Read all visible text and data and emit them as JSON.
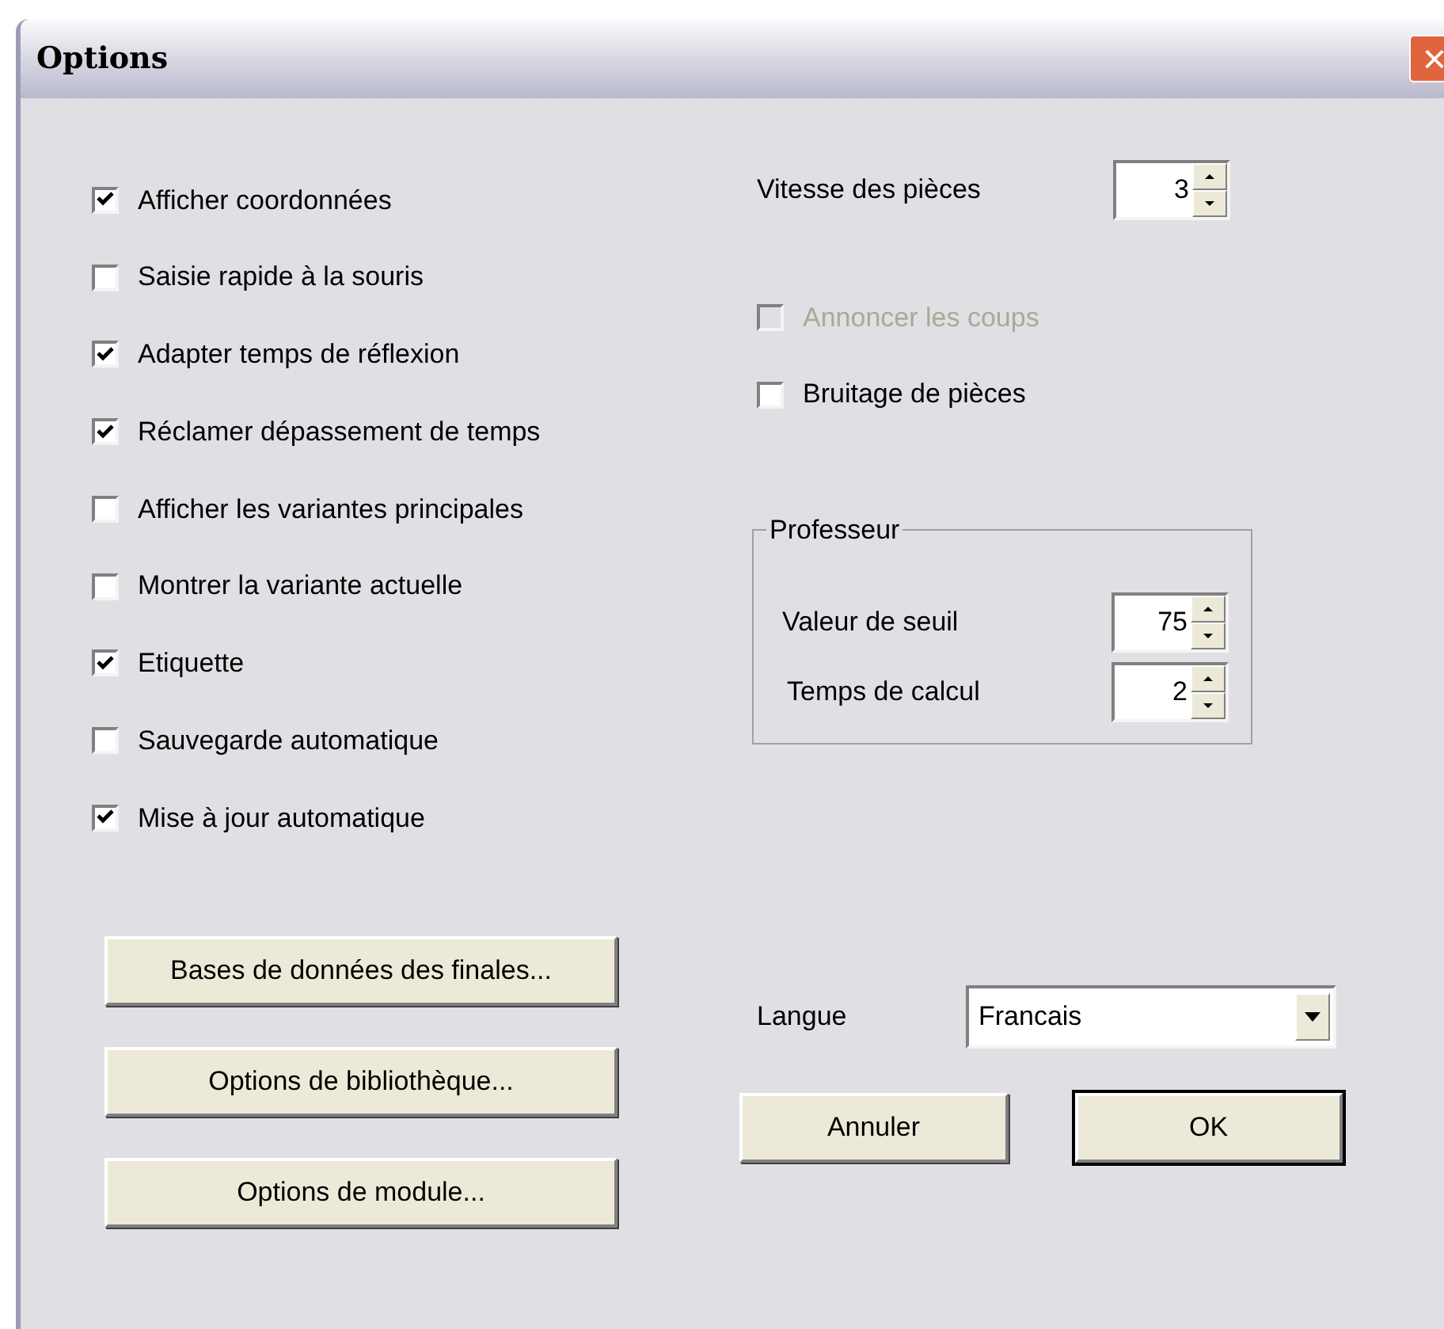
{
  "window": {
    "title": "Options",
    "close": "×"
  },
  "options": [
    {
      "label": "Afficher coordonnées",
      "checked": true
    },
    {
      "label": "Saisie rapide à la souris",
      "checked": false
    },
    {
      "label": "Adapter temps de réflexion",
      "checked": true
    },
    {
      "label": "Réclamer dépassement de temps",
      "checked": true
    },
    {
      "label": "Afficher les variantes principales",
      "checked": false
    },
    {
      "label": "Montrer la variante actuelle",
      "checked": false
    },
    {
      "label": "Etiquette",
      "checked": true
    },
    {
      "label": "Sauvegarde automatique",
      "checked": false
    },
    {
      "label": "Mise à jour automatique",
      "checked": true
    }
  ],
  "speed": {
    "label": "Vitesse des pièces",
    "value": "3"
  },
  "sound_options": [
    {
      "label": "Annoncer les coups",
      "checked": false,
      "disabled": true
    },
    {
      "label": "Bruitage de pièces",
      "checked": false,
      "disabled": false
    }
  ],
  "professeur": {
    "title": "Professeur",
    "spinners": [
      {
        "label": "Valeur de seuil",
        "value": "75"
      },
      {
        "label": "Temps de calcul",
        "value": "2"
      }
    ]
  },
  "left_buttons": [
    "Bases de données des finales...",
    "Options de bibliothèque...",
    "Options de module..."
  ],
  "language": {
    "label": "Langue",
    "value": "Francais"
  },
  "dialog_buttons": [
    {
      "label": "Annuler",
      "default": false
    },
    {
      "label": "OK",
      "default": true
    }
  ]
}
